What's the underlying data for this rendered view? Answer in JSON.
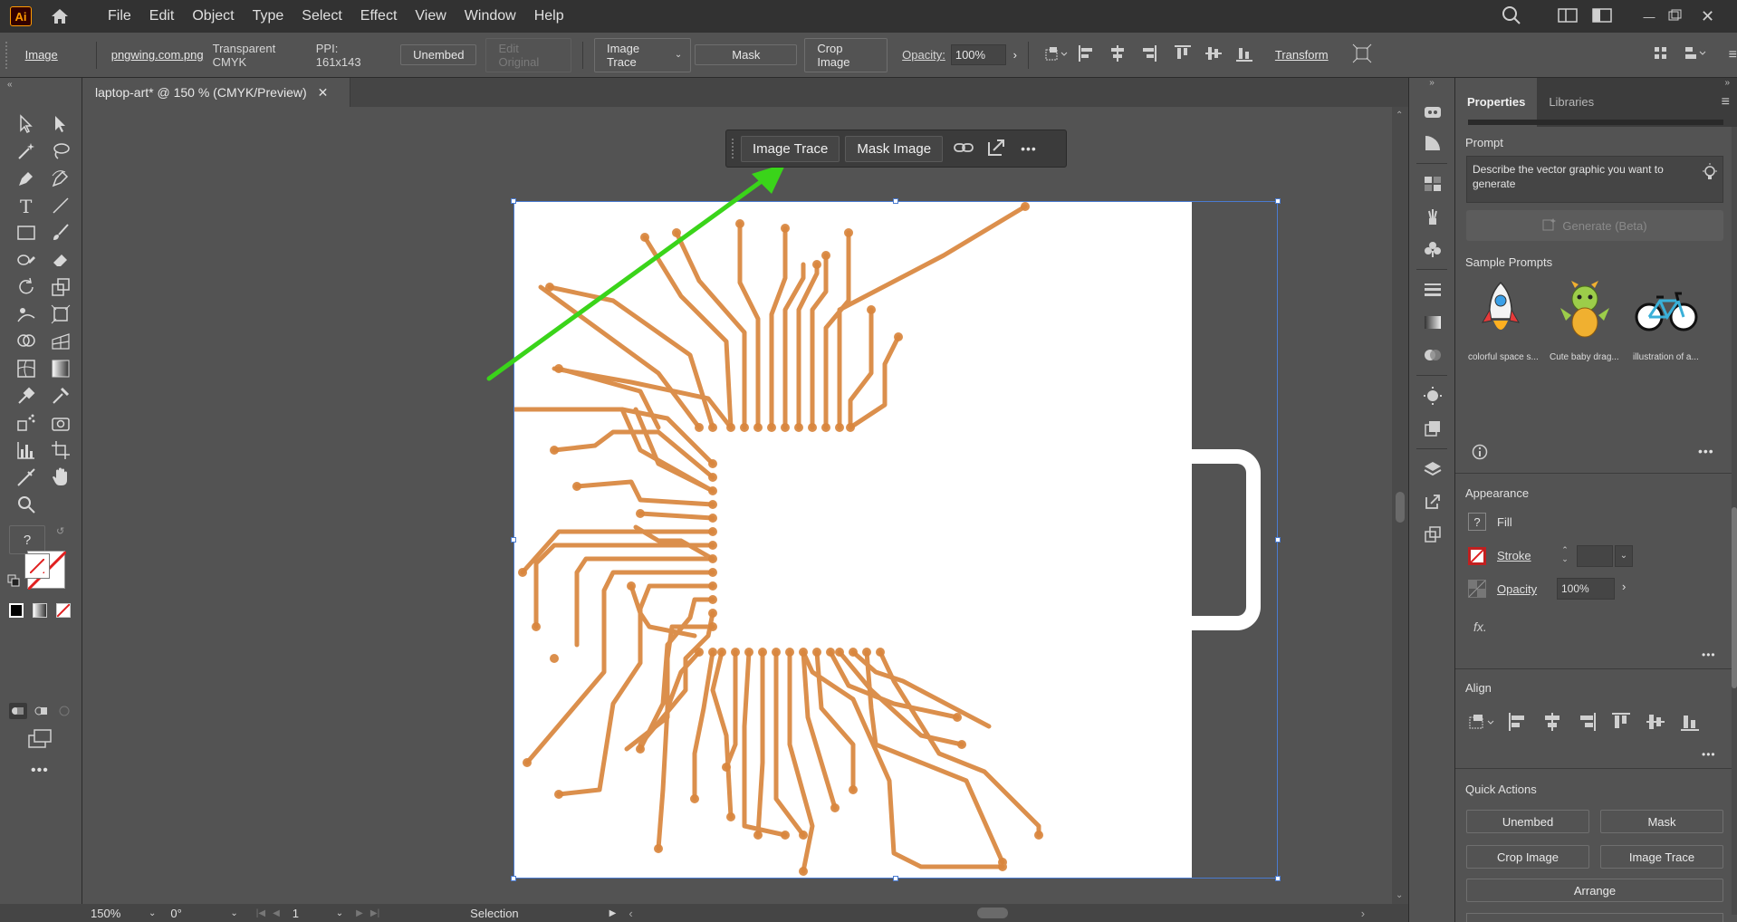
{
  "app": {
    "logo": "Ai",
    "menu": [
      "File",
      "Edit",
      "Object",
      "Type",
      "Select",
      "Effect",
      "View",
      "Window",
      "Help"
    ]
  },
  "controlbar": {
    "object_type": "Image",
    "file_name": "pngwing.com.png",
    "color_info": "Transparent CMYK",
    "ppi": "PPI: 161x143",
    "unembed": "Unembed",
    "edit_original": "Edit Original",
    "image_trace": "Image Trace",
    "mask": "Mask",
    "crop_image": "Crop Image",
    "opacity_label": "Opacity:",
    "opacity_value": "100%",
    "transform": "Transform"
  },
  "document": {
    "tab_title": "laptop-art* @ 150 % (CMYK/Preview)"
  },
  "taskbar": {
    "image_trace": "Image Trace",
    "mask_image": "Mask Image"
  },
  "statusbar": {
    "zoom": "150%",
    "rotation": "0°",
    "artboard": "1",
    "tool": "Selection"
  },
  "panel": {
    "tabs": [
      "Properties",
      "Libraries"
    ],
    "prompt_title": "Prompt",
    "prompt_placeholder": "Describe the vector graphic you want to generate",
    "generate_label": "Generate (Beta)",
    "sample_prompts_title": "Sample Prompts",
    "samples": [
      "colorful space s...",
      "Cute baby drag...",
      "illustration of a..."
    ],
    "appearance_title": "Appearance",
    "fill_label": "Fill",
    "stroke_label": "Stroke",
    "opacity_label": "Opacity",
    "opacity_value": "100%",
    "fx_label": "fx.",
    "align_title": "Align",
    "quick_actions_title": "Quick Actions",
    "qa_unembed": "Unembed",
    "qa_mask": "Mask",
    "qa_crop": "Crop Image",
    "qa_trace": "Image Trace",
    "qa_arrange": "Arrange"
  },
  "colors": {
    "circuit": "#d9863d",
    "arrow": "#3ad41a",
    "selection": "#4a7bd0"
  }
}
